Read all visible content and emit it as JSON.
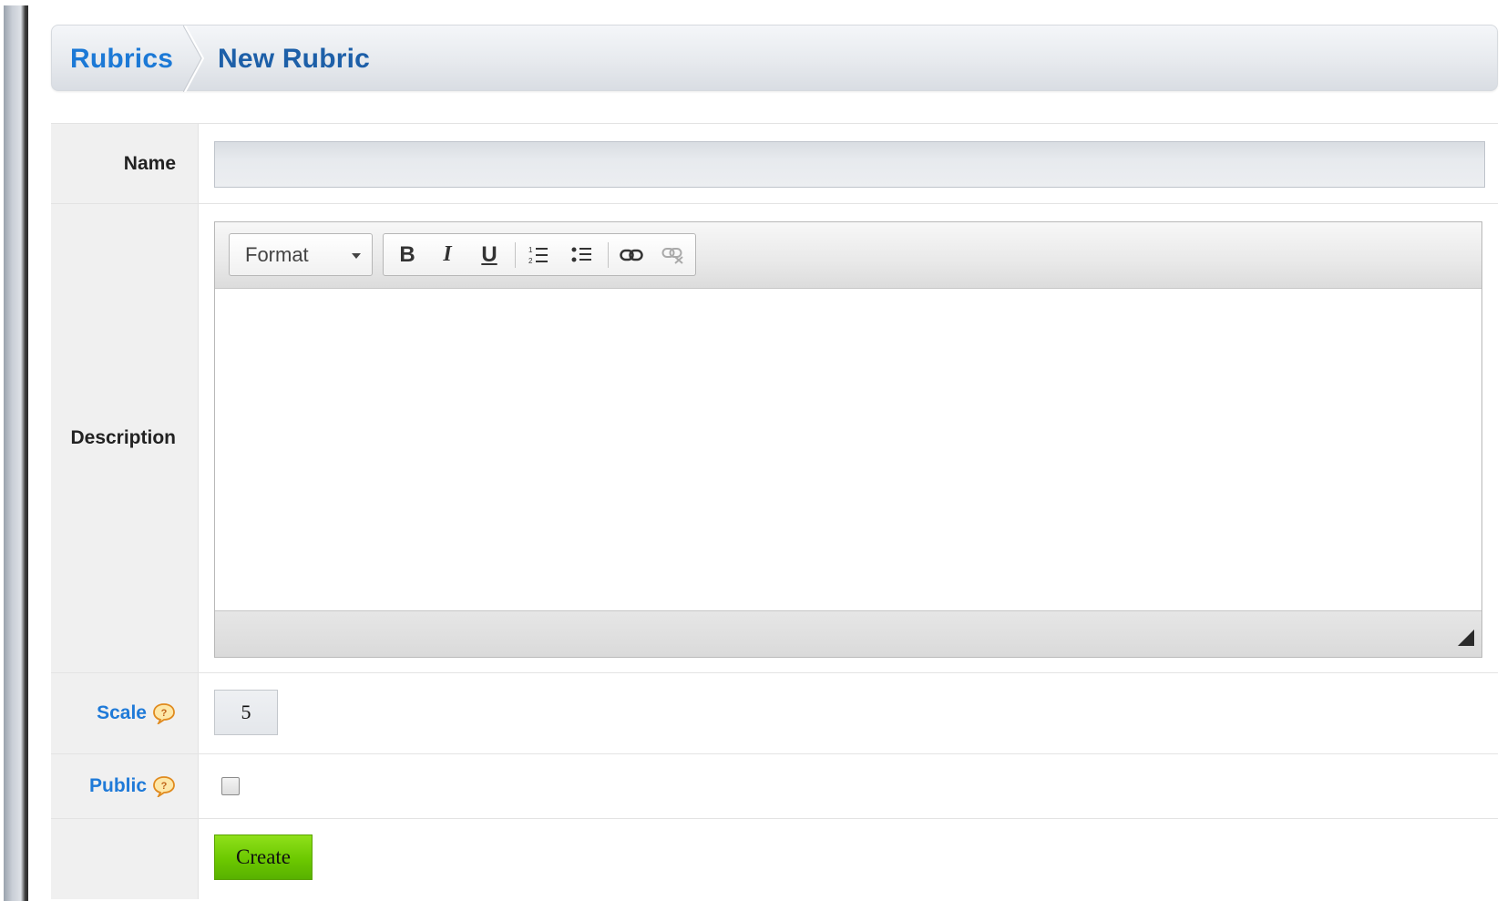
{
  "breadcrumb": {
    "root_label": "Rubrics",
    "current_label": "New Rubric"
  },
  "form": {
    "name": {
      "label": "Name",
      "value": ""
    },
    "description": {
      "label": "Description",
      "format_label": "Format",
      "toolbar_icons": [
        "bold-icon",
        "italic-icon",
        "underline-icon",
        "ordered-list-icon",
        "unordered-list-icon",
        "link-icon",
        "unlink-icon"
      ],
      "bold_glyph": "B",
      "italic_glyph": "I",
      "underline_glyph": "U"
    },
    "scale": {
      "label": "Scale",
      "value": "5",
      "help_icon": "help-bubble-icon"
    },
    "public": {
      "label": "Public",
      "checked": false,
      "help_icon": "help-bubble-icon"
    },
    "submit_label": "Create"
  },
  "colors": {
    "link_blue": "#1c79d6",
    "create_green": "#6cc800"
  }
}
